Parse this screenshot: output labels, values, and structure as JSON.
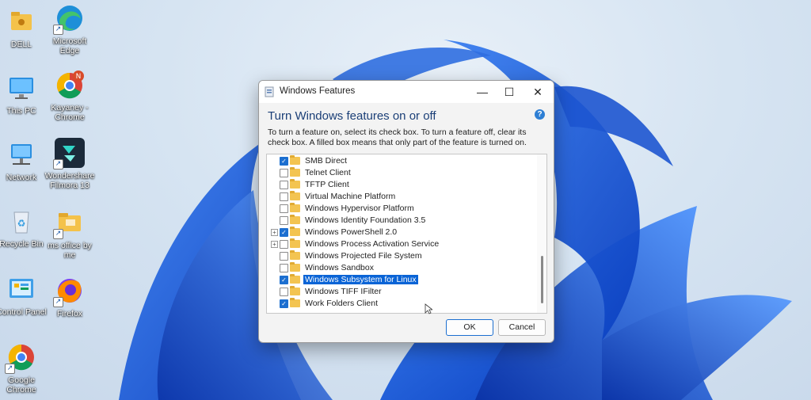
{
  "desktop": {
    "icons": [
      {
        "label": "DELL",
        "icon": "folder-icon"
      },
      {
        "label": "Microsoft Edge",
        "icon": "edge-icon"
      },
      {
        "label": "This PC",
        "icon": "computer-icon"
      },
      {
        "label": "Kayaney - Chrome",
        "icon": "chrome-profile-icon"
      },
      {
        "label": "Network",
        "icon": "network-icon"
      },
      {
        "label": "Wondershare Filmora 13",
        "icon": "filmora-icon"
      },
      {
        "label": "Recycle Bin",
        "icon": "recycle-bin-icon"
      },
      {
        "label": "ms office by me",
        "icon": "folder-icon"
      },
      {
        "label": "Control Panel",
        "icon": "control-panel-icon"
      },
      {
        "label": "Firefox",
        "icon": "firefox-icon"
      },
      {
        "label": "Google Chrome",
        "icon": "chrome-icon"
      }
    ]
  },
  "dialog": {
    "title": "Windows Features",
    "heading": "Turn Windows features on or off",
    "description": "To turn a feature on, select its check box. To turn a feature off, clear its check box. A filled box means that only part of the feature is turned on.",
    "minimize": "—",
    "maximize": "☐",
    "close": "✕",
    "help": "?",
    "features": [
      {
        "label": "SMB Direct",
        "checked": true,
        "expandable": false,
        "selected": false
      },
      {
        "label": "Telnet Client",
        "checked": false,
        "expandable": false,
        "selected": false
      },
      {
        "label": "TFTP Client",
        "checked": false,
        "expandable": false,
        "selected": false
      },
      {
        "label": "Virtual Machine Platform",
        "checked": false,
        "expandable": false,
        "selected": false
      },
      {
        "label": "Windows Hypervisor Platform",
        "checked": false,
        "expandable": false,
        "selected": false
      },
      {
        "label": "Windows Identity Foundation 3.5",
        "checked": false,
        "expandable": false,
        "selected": false
      },
      {
        "label": "Windows PowerShell 2.0",
        "checked": true,
        "expandable": true,
        "selected": false
      },
      {
        "label": "Windows Process Activation Service",
        "checked": false,
        "expandable": true,
        "selected": false
      },
      {
        "label": "Windows Projected File System",
        "checked": false,
        "expandable": false,
        "selected": false
      },
      {
        "label": "Windows Sandbox",
        "checked": false,
        "expandable": false,
        "selected": false
      },
      {
        "label": "Windows Subsystem for Linux",
        "checked": true,
        "expandable": false,
        "selected": true
      },
      {
        "label": "Windows TIFF IFilter",
        "checked": false,
        "expandable": false,
        "selected": false
      },
      {
        "label": "Work Folders Client",
        "checked": true,
        "expandable": false,
        "selected": false
      }
    ],
    "ok_label": "OK",
    "cancel_label": "Cancel"
  },
  "colors": {
    "accent": "#1c6fd0",
    "selection": "#0a64d6",
    "heading": "#1b3f77"
  }
}
